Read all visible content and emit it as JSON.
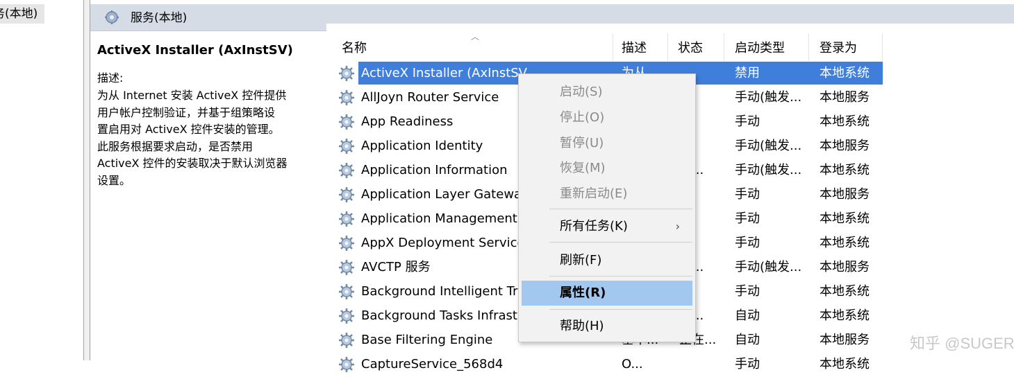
{
  "tree": {
    "item_label": "务(本地)"
  },
  "header": {
    "title": "服务(本地)"
  },
  "description": {
    "service_name": "ActiveX Installer (AxInstSV)",
    "label": "描述:",
    "lines": [
      "为从 Internet 安装 ActiveX 控件提供",
      "用户帐户控制验证，并基于组策略设",
      "置启用对 ActiveX 控件安装的管理。",
      "此服务根据要求启动，是否禁用",
      "ActiveX 控件的安装取决于默认浏览器",
      "设置。"
    ]
  },
  "columns": {
    "name": "名称",
    "desc": "描述",
    "status": "状态",
    "start": "启动类型",
    "logon": "登录为"
  },
  "rows": [
    {
      "name": "ActiveX Installer (AxInstSV)",
      "desc": "为从...",
      "status": "",
      "start": "禁用",
      "logon": "本地系统"
    },
    {
      "name": "AllJoyn Router Service",
      "desc": "",
      "status": "",
      "start": "手动(触发...",
      "logon": "本地服务"
    },
    {
      "name": "App Readiness",
      "desc": "",
      "status": "",
      "start": "手动",
      "logon": "本地系统"
    },
    {
      "name": "Application Identity",
      "desc": "",
      "status": "",
      "start": "手动(触发...",
      "logon": "本地服务"
    },
    {
      "name": "Application Information",
      "desc": "",
      "status": "在...",
      "start": "手动(触发...",
      "logon": "本地系统"
    },
    {
      "name": "Application Layer Gateway Service",
      "desc": "",
      "status": "",
      "start": "手动",
      "logon": "本地服务"
    },
    {
      "name": "Application Management",
      "desc": "",
      "status": "",
      "start": "手动",
      "logon": "本地系统"
    },
    {
      "name": "AppX Deployment Service",
      "desc": "",
      "status": "",
      "start": "手动",
      "logon": "本地系统"
    },
    {
      "name": "AVCTP 服务",
      "desc": "",
      "status": "在...",
      "start": "手动(触发...",
      "logon": "本地服务"
    },
    {
      "name": "Background Intelligent Transfer",
      "desc": "",
      "status": "",
      "start": "手动",
      "logon": "本地系统"
    },
    {
      "name": "Background Tasks Infrastructure",
      "desc": "",
      "status": "在...",
      "start": "自动",
      "logon": "本地系统"
    },
    {
      "name": "Base Filtering Engine",
      "desc": "基本...",
      "status": "正在...",
      "start": "自动",
      "logon": "本地服务"
    },
    {
      "name": "CaptureService_568d4",
      "desc": "O...",
      "status": "",
      "start": "手动",
      "logon": "本地系统"
    }
  ],
  "context_menu": {
    "start": "启动(S)",
    "stop": "停止(O)",
    "pause": "暂停(U)",
    "resume": "恢复(M)",
    "restart": "重新启动(E)",
    "all_tasks": "所有任务(K)",
    "refresh": "刷新(F)",
    "properties": "属性(R)",
    "help": "帮助(H)"
  },
  "watermark": "知乎 @SUGERBOOM",
  "colors": {
    "selection": "#3f7fdb",
    "menu_hot": "#a3c8f0",
    "header_bar": "#d6dce6"
  }
}
